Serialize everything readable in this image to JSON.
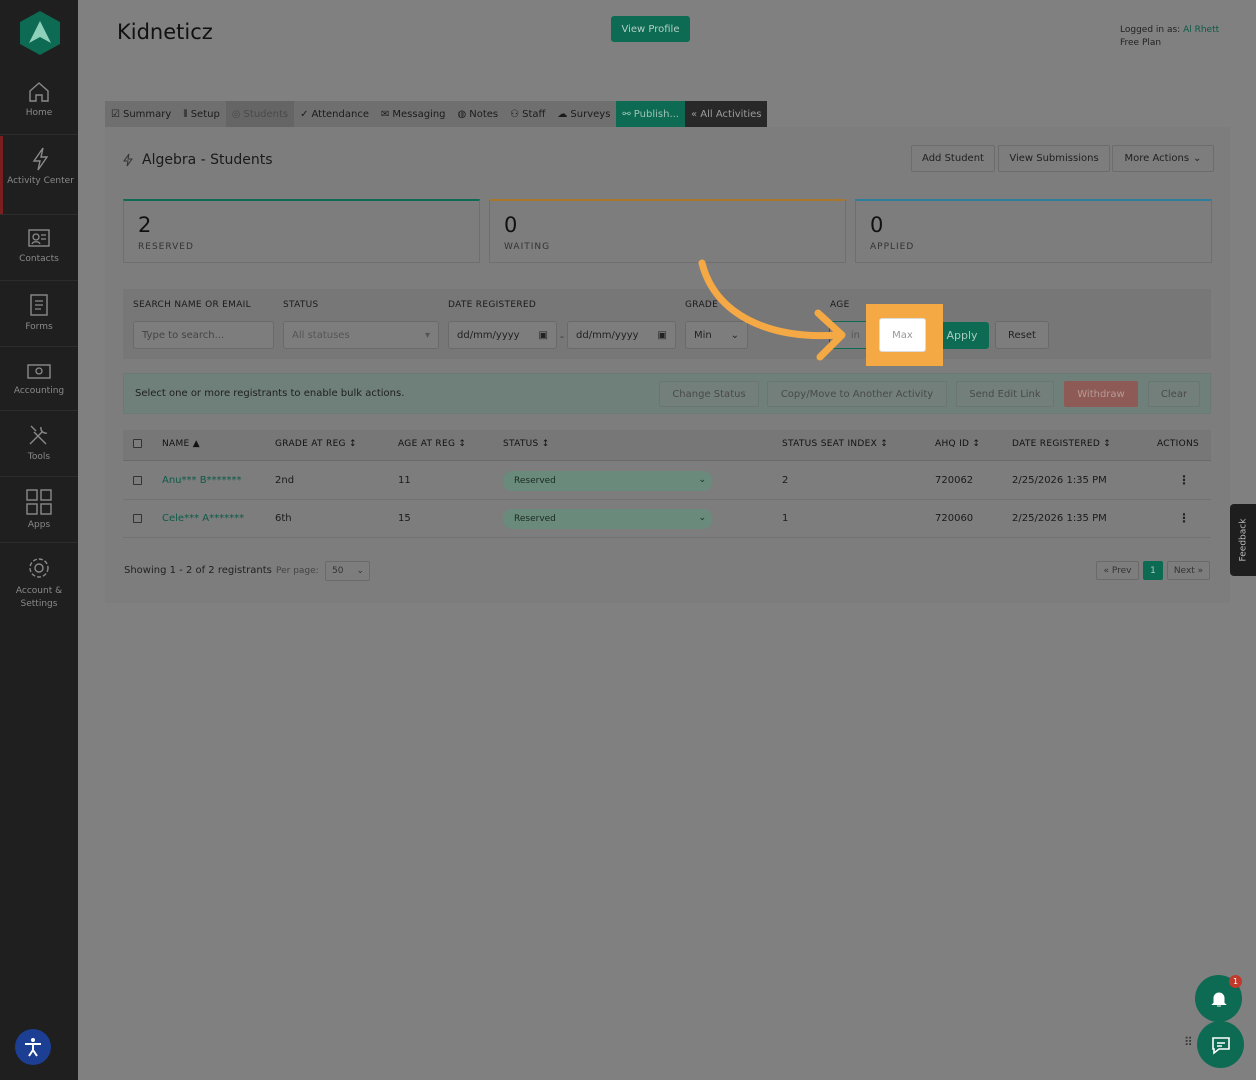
{
  "app": {
    "brand": "Kidneticz",
    "view_profile": "View Profile",
    "logged_in_label": "Logged in as: ",
    "user_name": "Al Rhett",
    "plan": "Free Plan"
  },
  "sidebar": {
    "items": [
      {
        "label": "Home",
        "icon": "home-icon"
      },
      {
        "label": "Activity Center",
        "icon": "bolt-icon"
      },
      {
        "label": "Contacts",
        "icon": "contacts-icon"
      },
      {
        "label": "Forms",
        "icon": "forms-icon"
      },
      {
        "label": "Accounting",
        "icon": "money-icon"
      },
      {
        "label": "Tools",
        "icon": "tools-icon"
      },
      {
        "label": "Apps",
        "icon": "apps-icon"
      },
      {
        "label": "Account & Settings",
        "icon": "gear-icon"
      }
    ]
  },
  "tabs": [
    "Summary",
    "Setup",
    "Students",
    "Attendance",
    "Messaging",
    "Notes",
    "Staff",
    "Surveys",
    "Publish...",
    "« All Activities"
  ],
  "page": {
    "title": "Algebra - Students",
    "add_student": "Add Student",
    "view_submissions": "View Submissions",
    "more_actions": "More Actions"
  },
  "stats": [
    {
      "value": "2",
      "label": "RESERVED",
      "color": "#0c6b52"
    },
    {
      "value": "0",
      "label": "WAITING",
      "color": "#a8772a"
    },
    {
      "value": "0",
      "label": "APPLIED",
      "color": "#2d7f9b"
    }
  ],
  "filters": {
    "search_label": "SEARCH NAME OR EMAIL",
    "search_placeholder": "Type to search...",
    "status_label": "STATUS",
    "status_value": "All statuses",
    "date_label": "DATE REGISTERED",
    "date_from": "dd/mm/yyyy",
    "date_to": "dd/mm/yyyy",
    "grade_label": "GRADE",
    "grade_min": "Min",
    "age_label": "AGE",
    "age_min": "in",
    "age_max": "Max",
    "apply": "Apply",
    "reset": "Reset"
  },
  "bulk": {
    "text": "Select one or more registrants to enable bulk actions.",
    "change_status": "Change Status",
    "copy_move": "Copy/Move to Another Activity",
    "send_edit": "Send Edit Link",
    "withdraw": "Withdraw",
    "clear": "Clear"
  },
  "table": {
    "headers": [
      "NAME ▲",
      "GRADE AT REG ↕",
      "AGE AT REG ↕",
      "STATUS ↕",
      "STATUS SEAT INDEX ↕",
      "AHQ ID ↕",
      "DATE REGISTERED ↕",
      "ACTIONS"
    ],
    "rows": [
      {
        "name": "Anu*** B*******",
        "grade": "2nd",
        "age": "11",
        "status": "Reserved",
        "seat": "2",
        "id": "720062",
        "date": "2/25/2026 1:35 PM"
      },
      {
        "name": "Cele*** A*******",
        "grade": "6th",
        "age": "15",
        "status": "Reserved",
        "seat": "1",
        "id": "720060",
        "date": "2/25/2026 1:35 PM"
      }
    ]
  },
  "footer": {
    "showing": "Showing 1 - 2 of 2 registrants",
    "per_page_label": "Per page:",
    "per_page": "50",
    "prev": "« Prev",
    "page": "1",
    "next": "Next »"
  },
  "widgets": {
    "feedback": "Feedback",
    "notification_count": "1"
  }
}
